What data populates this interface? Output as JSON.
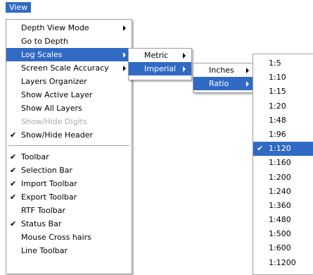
{
  "menubar": {
    "view_label": "View"
  },
  "main_menu": {
    "group1": [
      {
        "label": "Depth View Mode",
        "submenu": true,
        "highlighted": false,
        "disabled": false,
        "checked": false
      },
      {
        "label": "Go to Depth",
        "submenu": false,
        "highlighted": false,
        "disabled": false,
        "checked": false
      },
      {
        "label": "Log Scales",
        "submenu": true,
        "highlighted": true,
        "disabled": false,
        "checked": false
      },
      {
        "label": "Screen Scale Accuracy",
        "submenu": true,
        "highlighted": false,
        "disabled": false,
        "checked": false
      },
      {
        "label": "Layers Organizer",
        "submenu": false,
        "highlighted": false,
        "disabled": false,
        "checked": false
      },
      {
        "label": "Show Active Layer",
        "submenu": false,
        "highlighted": false,
        "disabled": false,
        "checked": false
      },
      {
        "label": "Show All Layers",
        "submenu": false,
        "highlighted": false,
        "disabled": false,
        "checked": false
      },
      {
        "label": "Show/Hide Digits",
        "submenu": false,
        "highlighted": false,
        "disabled": true,
        "checked": false
      },
      {
        "label": "Show/Hide Header",
        "submenu": false,
        "highlighted": false,
        "disabled": false,
        "checked": true
      }
    ],
    "group2": [
      {
        "label": "Toolbar",
        "checked": true
      },
      {
        "label": "Selection Bar",
        "checked": true
      },
      {
        "label": "Import Toolbar",
        "checked": true
      },
      {
        "label": "Export Toolbar",
        "checked": true
      },
      {
        "label": "RTF Toolbar",
        "checked": false
      },
      {
        "label": "Status Bar",
        "checked": true
      },
      {
        "label": "Mouse Cross hairs",
        "checked": false
      },
      {
        "label": "Line Toolbar",
        "checked": false
      }
    ]
  },
  "log_scales_menu": [
    {
      "label": "Metric",
      "highlighted": false
    },
    {
      "label": "Imperial",
      "highlighted": true
    }
  ],
  "imperial_menu": [
    {
      "label": "Inches",
      "highlighted": false
    },
    {
      "label": "Ratio",
      "highlighted": true
    }
  ],
  "ratio_menu": [
    {
      "label": "1:5",
      "checked": false,
      "highlighted": false
    },
    {
      "label": "1:10",
      "checked": false,
      "highlighted": false
    },
    {
      "label": "1:15",
      "checked": false,
      "highlighted": false
    },
    {
      "label": "1:20",
      "checked": false,
      "highlighted": false
    },
    {
      "label": "1:48",
      "checked": false,
      "highlighted": false
    },
    {
      "label": "1:96",
      "checked": false,
      "highlighted": false
    },
    {
      "label": "1:120",
      "checked": true,
      "highlighted": true
    },
    {
      "label": "1:160",
      "checked": false,
      "highlighted": false
    },
    {
      "label": "1:200",
      "checked": false,
      "highlighted": false
    },
    {
      "label": "1:240",
      "checked": false,
      "highlighted": false
    },
    {
      "label": "1:360",
      "checked": false,
      "highlighted": false
    },
    {
      "label": "1:480",
      "checked": false,
      "highlighted": false
    },
    {
      "label": "1:500",
      "checked": false,
      "highlighted": false
    },
    {
      "label": "1:600",
      "checked": false,
      "highlighted": false
    },
    {
      "label": "1:1200",
      "checked": false,
      "highlighted": false
    }
  ],
  "icons": {
    "check": "checkmark-icon",
    "submenu": "submenu-arrow-icon"
  },
  "colors": {
    "highlight": "#316ac5",
    "disabled_text": "#a8a8a8"
  }
}
